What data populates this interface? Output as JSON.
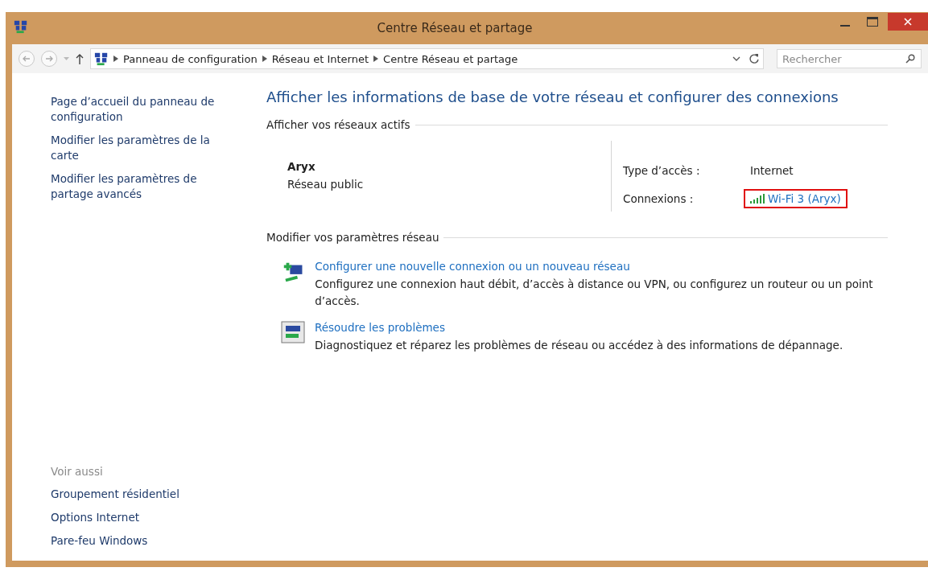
{
  "window": {
    "title": "Centre Réseau et partage"
  },
  "address_bar": {
    "breadcrumbs": [
      "Panneau de configuration",
      "Réseau et Internet",
      "Centre Réseau et partage"
    ],
    "search": {
      "placeholder": "Rechercher"
    }
  },
  "sidebar": {
    "links": [
      "Page d’accueil du panneau de configuration",
      "Modifier les paramètres de la carte",
      "Modifier les paramètres de partage avancés"
    ],
    "see_also": {
      "heading": "Voir aussi",
      "links": [
        "Groupement résidentiel",
        "Options Internet",
        "Pare-feu Windows"
      ]
    }
  },
  "main": {
    "heading": "Afficher les informations de base de votre réseau et configurer des connexions",
    "active_networks": {
      "heading": "Afficher vos réseaux actifs",
      "name": "Aryx",
      "category": "Réseau public",
      "details": [
        {
          "label": "Type d’accès :",
          "value": "Internet",
          "kind": "text",
          "highlighted": false
        },
        {
          "label": "Connexions :",
          "value": "Wi-Fi 3 (Aryx)",
          "kind": "link",
          "highlighted": true
        }
      ]
    },
    "settings": {
      "heading": "Modifier vos paramètres réseau",
      "tasks": [
        {
          "kind": "new-connection",
          "title": "Configurer une nouvelle connexion ou un nouveau réseau",
          "description": "Configurez une connexion haut débit, d’accès à distance ou VPN, ou configurez un routeur ou un point d’accès."
        },
        {
          "kind": "troubleshoot",
          "title": "Résoudre les problèmes",
          "description": "Diagnostiquez et réparez les problèmes de réseau ou accédez à des informations de dépannage."
        }
      ]
    }
  }
}
